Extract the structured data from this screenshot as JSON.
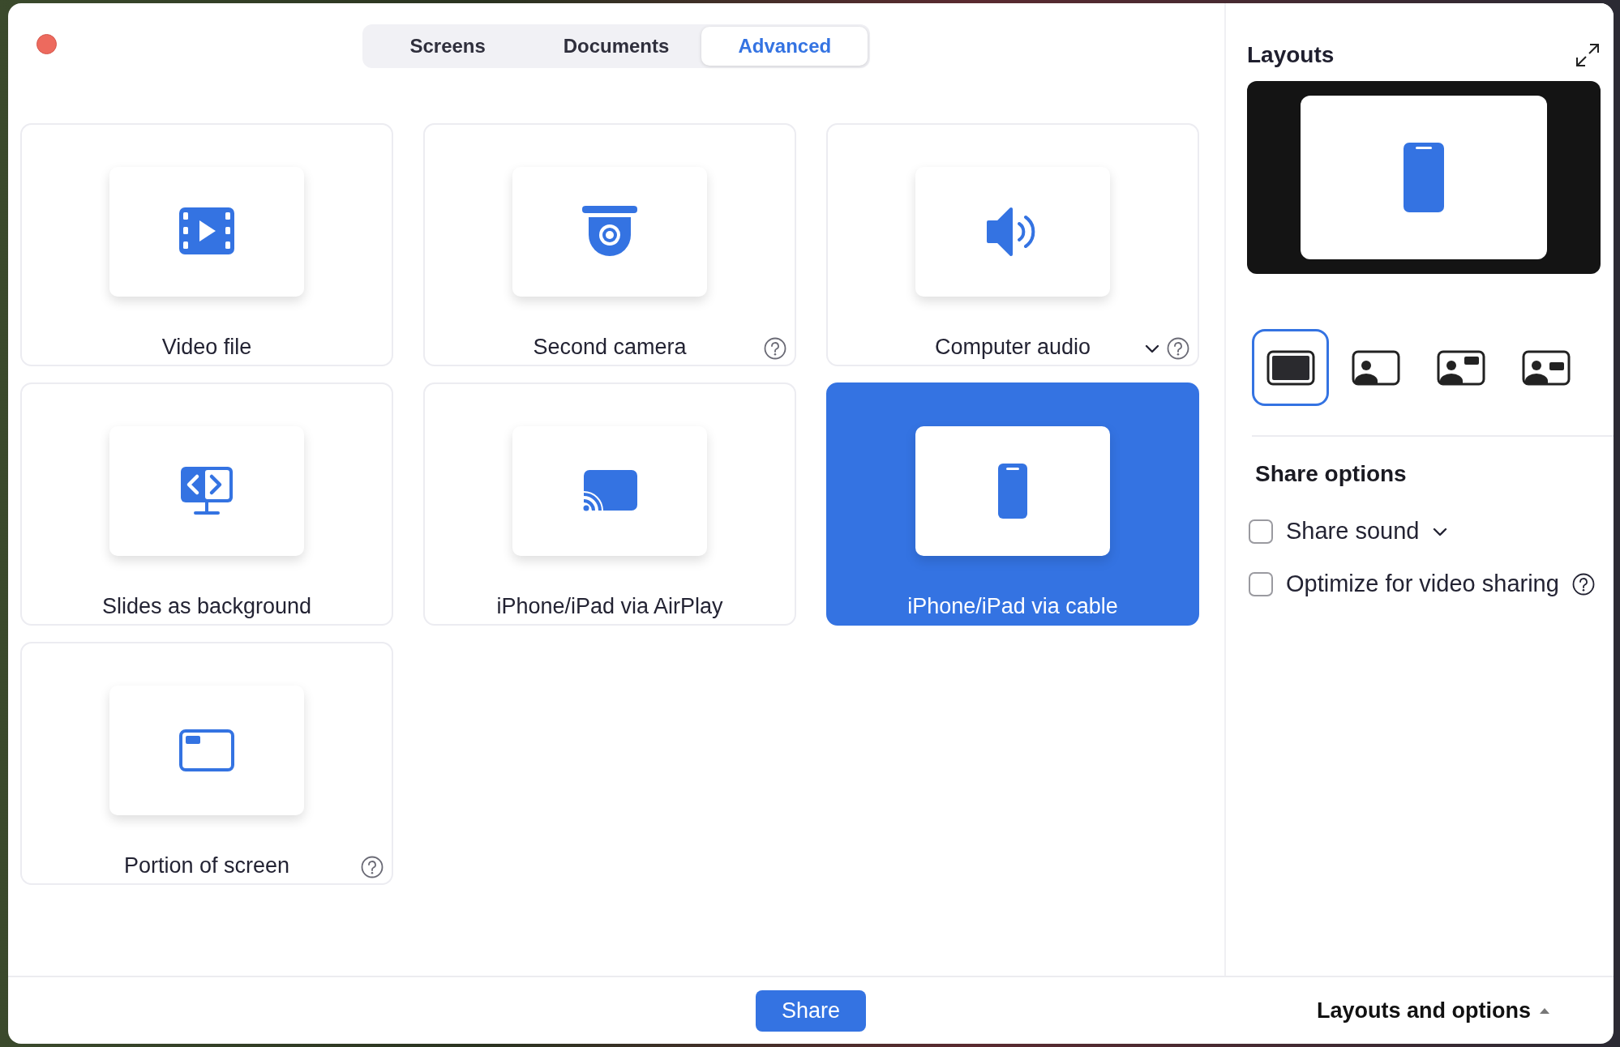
{
  "tabs": [
    {
      "label": "Screens",
      "selected": false
    },
    {
      "label": "Documents",
      "selected": false
    },
    {
      "label": "Advanced",
      "selected": true
    }
  ],
  "sources": [
    {
      "kind": "video-file",
      "label": "Video file",
      "selected": false,
      "help": false,
      "dropdown": false
    },
    {
      "kind": "camera",
      "label": "Second camera",
      "selected": false,
      "help": true,
      "dropdown": false
    },
    {
      "kind": "audio",
      "label": "Computer audio",
      "selected": false,
      "help": true,
      "dropdown": true
    },
    {
      "kind": "slides",
      "label": "Slides as background",
      "selected": false,
      "help": false,
      "dropdown": false
    },
    {
      "kind": "airplay",
      "label": "iPhone/iPad via AirPlay",
      "selected": false,
      "help": false,
      "dropdown": false
    },
    {
      "kind": "phone",
      "label": "iPhone/iPad via cable",
      "selected": true,
      "help": false,
      "dropdown": false
    },
    {
      "kind": "portion",
      "label": "Portion of screen",
      "selected": false,
      "help": true,
      "dropdown": false
    }
  ],
  "layouts": {
    "title": "Layouts",
    "options": [
      {
        "kind": "full",
        "selected": true
      },
      {
        "kind": "person",
        "selected": false
      },
      {
        "kind": "person-top",
        "selected": false
      },
      {
        "kind": "person-side",
        "selected": false
      }
    ]
  },
  "share_options": {
    "title": "Share options",
    "items": [
      {
        "label": "Share sound",
        "checked": false,
        "dropdown": true,
        "help": false
      },
      {
        "label": "Optimize for video sharing",
        "checked": false,
        "dropdown": false,
        "help": true
      }
    ]
  },
  "footer": {
    "share_button": "Share",
    "toggle": "Layouts and options",
    "expanded": true
  }
}
